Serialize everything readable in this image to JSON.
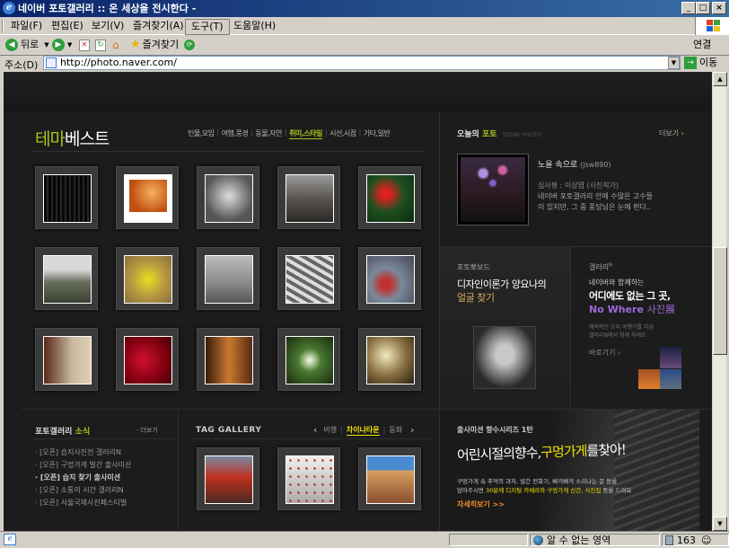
{
  "window": {
    "title": "네이버 포토갤러리 :: 온 세상을 전시한다 -",
    "min": "_",
    "max": "□",
    "close": "×"
  },
  "menu": [
    "파일(F)",
    "편집(E)",
    "보기(V)",
    "즐겨찾기(A)",
    "도구(T)",
    "도움말(H)"
  ],
  "toolbar": {
    "back": "뒤로",
    "favorites": "즐겨찾기",
    "links": "연결"
  },
  "address": {
    "label": "주소(D)",
    "url": "http://photo.naver.com/",
    "go": "이동"
  },
  "theme_best": {
    "title_accent": "테마",
    "title_rest": "베스트",
    "categories": [
      "인물,모임",
      "여행,풍경",
      "동물,자연",
      "취미,스타일",
      "시선,시점",
      "기타,일반"
    ],
    "active_index": 3
  },
  "today_photo": {
    "label_a": "오늘의",
    "label_b": "포토",
    "label_en": "TODAY PHOTO",
    "more": "더보기",
    "photo_title": "노을 속으로",
    "author_id": "(jsw890)",
    "judge": "심사평 : 이상엽 (사진작가)",
    "desc_line1": "네이버 포토갤러리 안에 수많은 고수들",
    "desc_line2": "이 있지만, 그 중 풍당님은 눈에 띈다.."
  },
  "photo_board": {
    "label": "포토뽀보드",
    "title_line1": "디자인이론가 양요나의",
    "title_line2": "얼굴 찾기"
  },
  "gallery_n": {
    "label": "갤러리",
    "label_sup": "N",
    "line1": "네이버와 함께하는",
    "line2": "어디에도 없는 그 곳,",
    "line3_a": "No Where",
    "line3_b": "사진展",
    "desc1": "매력적인 오지 여행기를 지금",
    "desc2": "갤러리N에서 함께 하세요",
    "more": "바로가기"
  },
  "news": {
    "title_a": "포토갤러리",
    "title_b": "소식",
    "more": "더보기",
    "items": [
      "[오픈] 습지사진전 갤러리N",
      "[오픈] 구멍가게 빌간 출사미션",
      "[오픈] 습지 찾기 출사미션",
      "[오픈] 소통의 시간 갤러리N",
      "[오픈] 서울국제사진페스티벌"
    ]
  },
  "tag_gallery": {
    "title": "TAG GALLERY",
    "tags": [
      "비행",
      "차이나타운",
      "동화"
    ],
    "active_index": 1,
    "prev": "‹",
    "next": "›"
  },
  "mission": {
    "label": "출사미션 향수시리즈 1탄",
    "headline_a": "어린시절의향수,",
    "headline_b": "구멍가게",
    "headline_c": "를찾아!",
    "desc1": "구멍가게 속 추억의 과자, 빌간 전화기, 삐걱삐걱 소리나는 문 등을",
    "desc2_a": "담아주시면",
    "desc2_b": "30분께 디지털 카메라와 구멍가게 신간, 사진집",
    "desc2_c": "등을 드려요",
    "cta": "자세히보기 >>"
  },
  "status": {
    "zone": "알 수 없는 영역",
    "count": "163"
  },
  "colors": {
    "accent_green": "#a5c51c",
    "accent_yellow": "#f0e000",
    "purple": "#9b6ad8",
    "orange": "#f08a2b",
    "page_bg": "#1c1c1c"
  },
  "icons": [
    "ie-icon",
    "back-icon",
    "forward-icon",
    "stop-icon",
    "refresh-icon",
    "home-icon",
    "favorites-icon",
    "history-icon",
    "go-icon",
    "globe-icon",
    "lock-icon"
  ]
}
